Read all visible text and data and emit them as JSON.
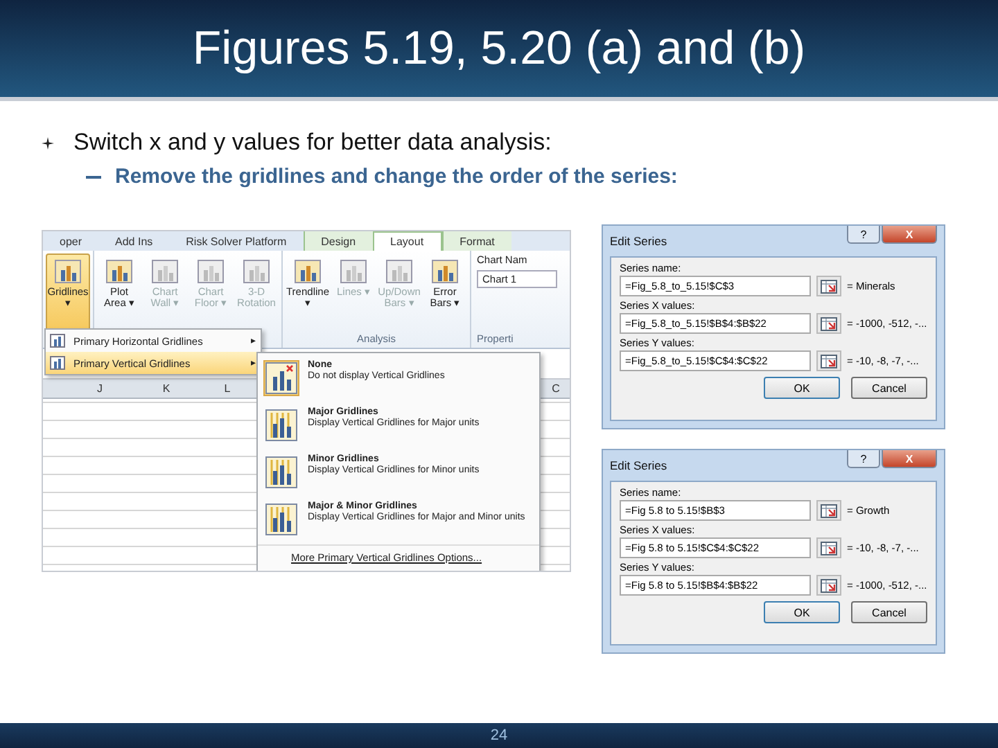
{
  "slide": {
    "title": "Figures 5.19, 5.20 (a) and (b)",
    "bullets": [
      {
        "text": "Switch x and y values for better data analysis:",
        "children": [
          {
            "text": "Remove the gridlines and change the order of the series:"
          }
        ]
      }
    ],
    "page_number": "24"
  },
  "ribbon": {
    "tabs": [
      {
        "label": "oper",
        "selected": false,
        "contextual": false
      },
      {
        "label": "Add Ins",
        "selected": false,
        "contextual": false
      },
      {
        "label": "Risk Solver Platform",
        "selected": false,
        "contextual": false
      },
      {
        "label": "Design",
        "selected": false,
        "contextual": true
      },
      {
        "label": "Layout",
        "selected": true,
        "contextual": true
      },
      {
        "label": "Format",
        "selected": false,
        "contextual": true
      }
    ],
    "groups": [
      {
        "buttons": [
          {
            "label": "Gridlines ▾",
            "pressed": true,
            "disabled": false
          }
        ]
      },
      {
        "buttons": [
          {
            "label": "Plot Area ▾",
            "pressed": false,
            "disabled": false
          },
          {
            "label": "Chart Wall ▾",
            "pressed": false,
            "disabled": true
          },
          {
            "label": "Chart Floor ▾",
            "pressed": false,
            "disabled": true
          },
          {
            "label": "3-D Rotation",
            "pressed": false,
            "disabled": true
          }
        ]
      },
      {
        "label": "Analysis",
        "buttons": [
          {
            "label": "Trendline ▾",
            "pressed": false,
            "disabled": false
          },
          {
            "label": "Lines ▾",
            "pressed": false,
            "disabled": true
          },
          {
            "label": "Up/Down Bars ▾",
            "pressed": false,
            "disabled": true
          },
          {
            "label": "Error Bars ▾",
            "pressed": false,
            "disabled": false
          }
        ]
      }
    ],
    "chart_name": {
      "label": "Chart Nam",
      "value": "Chart 1",
      "group_label": "Properti"
    }
  },
  "sheet": {
    "columns": [
      "J",
      "K",
      "L",
      "C"
    ]
  },
  "gridlines_menu": {
    "items": [
      {
        "label": "Primary Horizontal Gridlines",
        "arrow": "▸",
        "selected": false
      },
      {
        "label": "Primary Vertical Gridlines",
        "arrow": "▸",
        "selected": true
      }
    ]
  },
  "submenu": {
    "options": [
      {
        "title": "None",
        "description": "Do not display Vertical Gridlines",
        "selected": true
      },
      {
        "title": "Major Gridlines",
        "description": "Display Vertical Gridlines for Major units",
        "selected": false
      },
      {
        "title": "Minor Gridlines",
        "description": "Display Vertical Gridlines for Minor units",
        "selected": false
      },
      {
        "title": "Major & Minor Gridlines",
        "description": "Display Vertical Gridlines for Major and Minor units",
        "selected": false
      }
    ],
    "more": "More Primary Vertical Gridlines Options..."
  },
  "dialogs": [
    {
      "title": "Edit Series",
      "help": "?",
      "close": "X",
      "fields": [
        {
          "label": "Series name:",
          "value": "=Fig_5.8_to_5.15!$C$3",
          "result": "= Minerals"
        },
        {
          "label": "Series X values:",
          "value": "=Fig_5.8_to_5.15!$B$4:$B$22",
          "result": "= -1000, -512, -..."
        },
        {
          "label": "Series Y values:",
          "value": "=Fig_5.8_to_5.15!$C$4:$C$22",
          "result": "= -10, -8, -7, -..."
        }
      ],
      "buttons": [
        "OK",
        "Cancel"
      ]
    },
    {
      "title": "Edit Series",
      "help": "?",
      "close": "X",
      "fields": [
        {
          "label": "Series name:",
          "value": "=Fig 5.8 to 5.15!$B$3",
          "result": "= Growth"
        },
        {
          "label": "Series X values:",
          "value": "=Fig 5.8 to 5.15!$C$4:$C$22",
          "result": "= -10, -8, -7, -..."
        },
        {
          "label": "Series Y values:",
          "value": "=Fig 5.8 to 5.15!$B$4:$B$22",
          "result": "= -1000, -512, -..."
        }
      ],
      "buttons": [
        "OK",
        "Cancel"
      ]
    }
  ]
}
